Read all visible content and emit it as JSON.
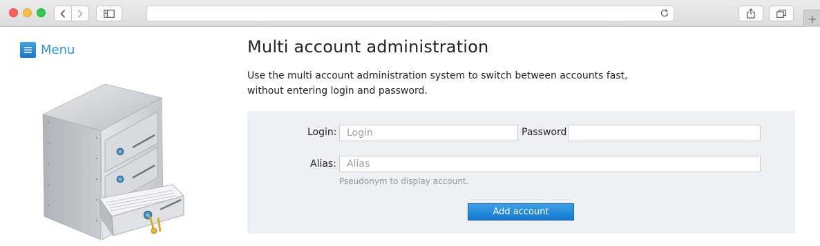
{
  "browser": {
    "back_icon": "chevron-left-icon",
    "forward_icon": "chevron-right-icon",
    "url": "",
    "new_tab_symbol": "+"
  },
  "menu": {
    "icon": "hamburger-icon",
    "label": "Menu"
  },
  "page": {
    "title": "Multi account administration",
    "description_lines": [
      "Use the multi account administration system to switch between accounts fast,",
      "without entering login and password."
    ]
  },
  "form": {
    "login_label": "Login:",
    "login_placeholder": "Login",
    "login_value": "",
    "password_label": "Password:",
    "password_value": "",
    "alias_label": "Alias:",
    "alias_placeholder": "Alias",
    "alias_value": "",
    "alias_hint": "Pseudonym to display account.",
    "submit_label": "Add account"
  },
  "colors": {
    "accent": "#2c93d6",
    "panel_bg": "#eef1f4",
    "button_bg": "#1e82d8"
  }
}
